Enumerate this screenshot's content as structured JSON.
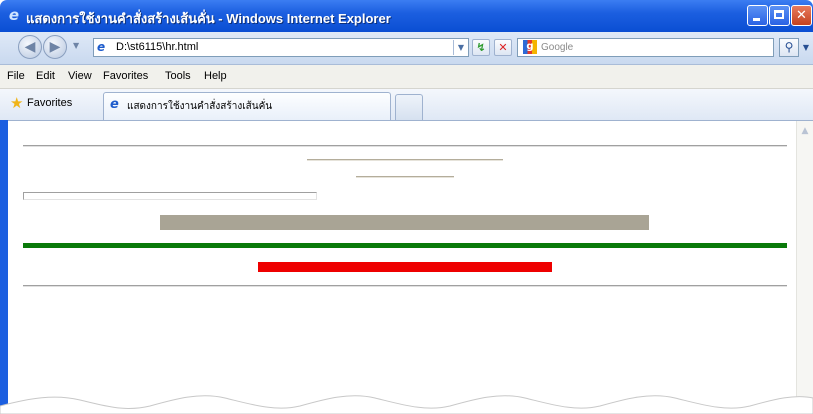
{
  "window": {
    "title": "แสดงการใช้งานคำสั่งสร้างเส้นคั่น - Windows Internet Explorer"
  },
  "navigation": {
    "address": "D:\\st6115\\hr.html",
    "search_placeholder": "Google"
  },
  "menu": {
    "items": [
      "File",
      "Edit",
      "View",
      "Favorites",
      "Tools",
      "Help"
    ]
  },
  "favorites_bar": {
    "label": "Favorites",
    "tab_label": "แสดงการใช้งานคำสั่งสร้างเส้นคั่น"
  },
  "content": {
    "horizontal_rules": [
      {
        "color": "#a0a0a0",
        "style": "shaded"
      },
      {
        "color": "#b4ad9b",
        "style": "shaded"
      },
      {
        "color": "#b4ad9b",
        "style": "shaded"
      },
      {
        "color": "#a0a0a0",
        "style": "hollow"
      },
      {
        "color": "#a9a495",
        "style": "solid"
      },
      {
        "color": "#0a7a0a",
        "style": "solid"
      },
      {
        "color": "#ee0000",
        "style": "solid"
      },
      {
        "color": "#a0a0a0",
        "style": "shaded"
      }
    ]
  },
  "colors": {
    "titlebar": "#0a4ed3",
    "green_rule": "#0a7a0a",
    "red_rule": "#ee0000",
    "gray_rule": "#a9a495"
  }
}
